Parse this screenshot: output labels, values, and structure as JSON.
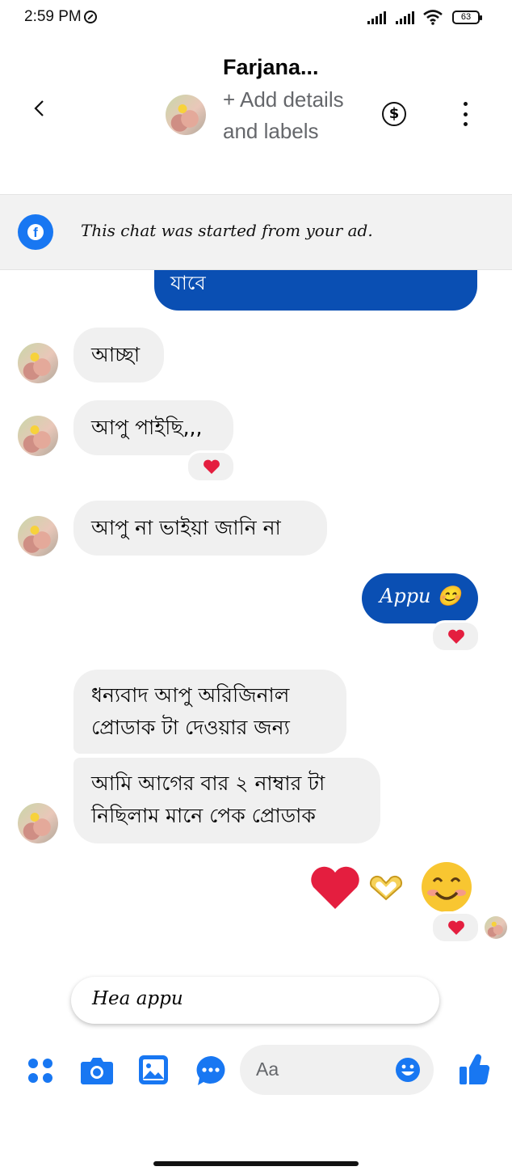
{
  "status_bar": {
    "time": "2:59 PM",
    "battery": "63"
  },
  "header": {
    "name": "Farjana...",
    "subtitle": "+ Add details and labels"
  },
  "ad_banner": {
    "icon": "facebook-icon",
    "text": "This chat was started from your ad."
  },
  "messages": {
    "m0": {
      "text": "যাবে"
    },
    "m1": {
      "text": "আচ্ছা"
    },
    "m2": {
      "text": "আপু পাইছি,,,",
      "reaction": "heart"
    },
    "m3": {
      "text": "আপু না ভাইয়া জানি না"
    },
    "m4": {
      "text": "Appu 😊",
      "reaction": "heart"
    },
    "m5": {
      "line1": "ধন্যবাদ  আপু অরিজিনাল",
      "line2": "প্রোডাক টা দেওয়ার জন্য"
    },
    "m6": {
      "line1": "আমি আগের বার ২ নাম্বার টা",
      "line2": "নিছিলাম মানে পেক প্রোডাক"
    },
    "m7": {
      "emojis": "❤️🫶😊",
      "reaction": "heart"
    }
  },
  "suggested_reply": "Hea appu",
  "composer": {
    "placeholder": "Aa",
    "actions": [
      "apps-icon",
      "camera-icon",
      "gallery-icon",
      "chat-icon",
      "emoji-icon",
      "like-icon"
    ]
  },
  "colors": {
    "accent": "#1877f2",
    "sent_bubble": "#0a4fb3",
    "received_bubble": "#f0f0f0",
    "heart": "#e41e3f"
  }
}
